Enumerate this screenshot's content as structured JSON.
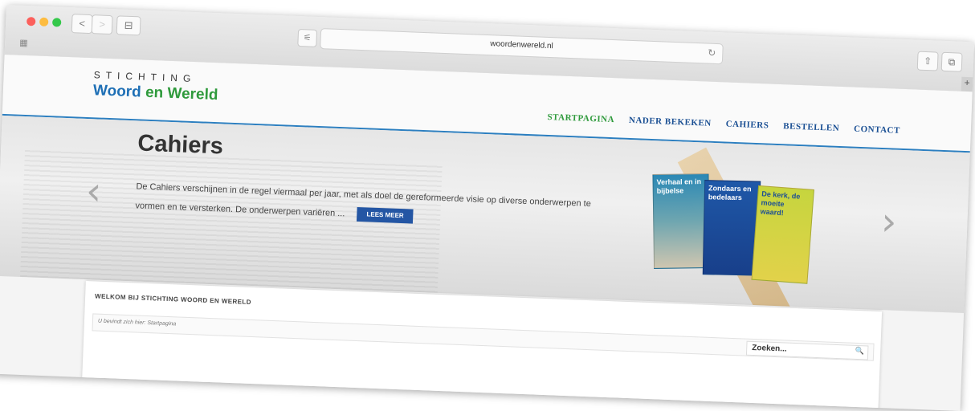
{
  "browser": {
    "url": "woordenwereld.nl",
    "back_label": "<",
    "forward_label": ">",
    "sidebar_label": "⊟",
    "reader_label": "⚟",
    "reload_label": "↻",
    "share_label": "⇧",
    "tabs_label": "⧉",
    "grid_label": "▦",
    "plus_label": "+"
  },
  "site": {
    "logo_top": "STICHTING",
    "logo_word1": "Woord",
    "logo_word2": "en Wereld"
  },
  "nav": {
    "items": [
      "STARTPAGINA",
      "NADER BEKEKEN",
      "CAHIERS",
      "BESTELLEN",
      "CONTACT"
    ]
  },
  "hero": {
    "title": "Cahiers",
    "text": "De Cahiers verschijnen in de regel viermaal per jaar, met als doel de gereformeerde visie op diverse onderwerpen te vormen en te versterken. De onderwerpen variëren ...",
    "button": "LEES MEER",
    "prev_label": "‹",
    "next_label": "›",
    "books": [
      "Verhaal en in bijbelse",
      "Zondaars en bedelaars",
      "De kerk, de moeite waard!"
    ]
  },
  "content": {
    "welcome": "WELKOM BIJ STICHTING WOORD EN WERELD",
    "breadcrumb": "U bevindt zich hier: Startpagina",
    "search_placeholder": "Zoeken...",
    "search_icon": "🔍"
  }
}
